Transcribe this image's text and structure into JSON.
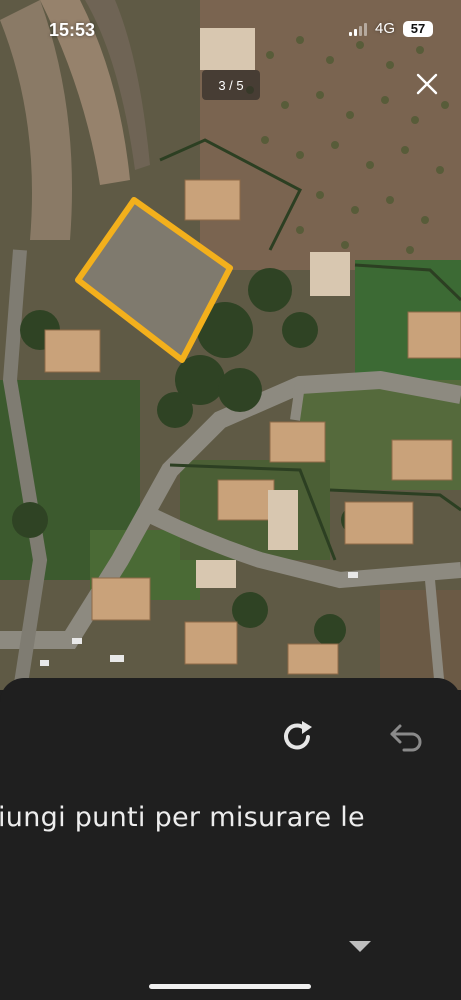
{
  "status_bar": {
    "time": "15:53",
    "network": "4G",
    "battery": "57"
  },
  "viewer": {
    "page_counter": "3 / 5",
    "close_icon": "close-icon"
  },
  "map": {
    "type": "satellite-image",
    "selection_color": "#f3b01c"
  },
  "panel": {
    "redo_icon": "redo-icon",
    "undo_icon": "undo-icon",
    "instruction": "iungi punti per misurare le",
    "dropdown_icon": "chevron-down-icon"
  }
}
